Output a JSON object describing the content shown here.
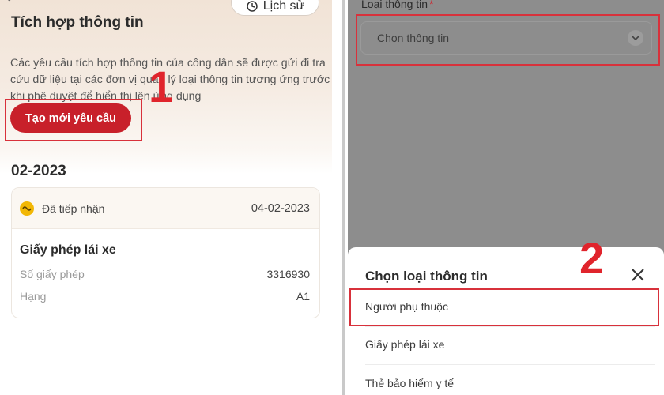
{
  "left_screen": {
    "history_label": "Lịch sử",
    "title": "Tích hợp thông tin",
    "description": "Các yêu cầu tích hợp thông tin của công dân sẽ được gửi đi tra cứu dữ liệu tại các đơn vị quản lý loại thông tin tương ứng trước khi phê duyệt để hiển thị lên ứng dụng",
    "create_button": "Tạo mới yêu cầu",
    "step_marker": "1",
    "period": "02-2023",
    "card": {
      "status": "Đã tiếp nhận",
      "date": "04-02-2023",
      "doc_title": "Giấy phép lái xe",
      "rows": [
        {
          "key": "Số giấy phép",
          "value": "3316930"
        },
        {
          "key": "Hạng",
          "value": "A1"
        }
      ]
    }
  },
  "right_screen": {
    "field_label": "Loại thông tin",
    "required_mark": "*",
    "select_placeholder": "Chọn thông tin",
    "sheet_title": "Chọn loại thông tin",
    "step_marker": "2",
    "options": [
      "Người phụ thuộc",
      "Giấy phép lái xe",
      "Thẻ bảo hiểm y tế"
    ]
  },
  "colors": {
    "accent_red": "#c8202a",
    "annotation_red": "#e0242c",
    "status_yellow": "#f2b705"
  },
  "icons": [
    "back-arrow-icon",
    "clock-history-icon",
    "status-icon",
    "chevron-down-icon",
    "close-icon"
  ]
}
